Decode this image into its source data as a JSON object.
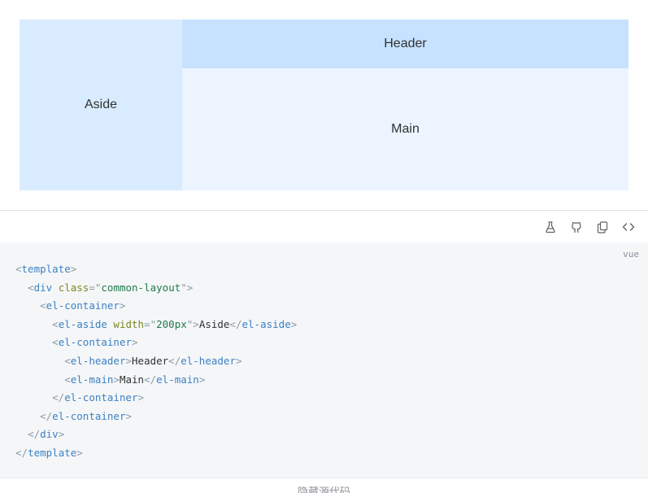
{
  "preview": {
    "aside_label": "Aside",
    "header_label": "Header",
    "main_label": "Main"
  },
  "toolbar": {
    "buttons": [
      "playground-icon",
      "github-icon",
      "copy-icon",
      "code-icon"
    ]
  },
  "code": {
    "language": "vue",
    "lines": [
      [
        {
          "t": "punc",
          "v": "<"
        },
        {
          "t": "tag",
          "v": "template"
        },
        {
          "t": "punc",
          "v": ">"
        }
      ],
      [
        {
          "t": "text",
          "v": "  "
        },
        {
          "t": "punc",
          "v": "<"
        },
        {
          "t": "tag",
          "v": "div "
        },
        {
          "t": "attr",
          "v": "class"
        },
        {
          "t": "punc",
          "v": "=\""
        },
        {
          "t": "str",
          "v": "common-layout"
        },
        {
          "t": "punc",
          "v": "\">"
        }
      ],
      [
        {
          "t": "text",
          "v": "    "
        },
        {
          "t": "punc",
          "v": "<"
        },
        {
          "t": "tag",
          "v": "el-container"
        },
        {
          "t": "punc",
          "v": ">"
        }
      ],
      [
        {
          "t": "text",
          "v": "      "
        },
        {
          "t": "punc",
          "v": "<"
        },
        {
          "t": "tag",
          "v": "el-aside "
        },
        {
          "t": "attr",
          "v": "width"
        },
        {
          "t": "punc",
          "v": "=\""
        },
        {
          "t": "str",
          "v": "200px"
        },
        {
          "t": "punc",
          "v": "\">"
        },
        {
          "t": "text",
          "v": "Aside"
        },
        {
          "t": "punc",
          "v": "</"
        },
        {
          "t": "tag",
          "v": "el-aside"
        },
        {
          "t": "punc",
          "v": ">"
        }
      ],
      [
        {
          "t": "text",
          "v": "      "
        },
        {
          "t": "punc",
          "v": "<"
        },
        {
          "t": "tag",
          "v": "el-container"
        },
        {
          "t": "punc",
          "v": ">"
        }
      ],
      [
        {
          "t": "text",
          "v": "        "
        },
        {
          "t": "punc",
          "v": "<"
        },
        {
          "t": "tag",
          "v": "el-header"
        },
        {
          "t": "punc",
          "v": ">"
        },
        {
          "t": "text",
          "v": "Header"
        },
        {
          "t": "punc",
          "v": "</"
        },
        {
          "t": "tag",
          "v": "el-header"
        },
        {
          "t": "punc",
          "v": ">"
        }
      ],
      [
        {
          "t": "text",
          "v": "        "
        },
        {
          "t": "punc",
          "v": "<"
        },
        {
          "t": "tag",
          "v": "el-main"
        },
        {
          "t": "punc",
          "v": ">"
        },
        {
          "t": "text",
          "v": "Main"
        },
        {
          "t": "punc",
          "v": "</"
        },
        {
          "t": "tag",
          "v": "el-main"
        },
        {
          "t": "punc",
          "v": ">"
        }
      ],
      [
        {
          "t": "text",
          "v": "      "
        },
        {
          "t": "punc",
          "v": "</"
        },
        {
          "t": "tag",
          "v": "el-container"
        },
        {
          "t": "punc",
          "v": ">"
        }
      ],
      [
        {
          "t": "text",
          "v": "    "
        },
        {
          "t": "punc",
          "v": "</"
        },
        {
          "t": "tag",
          "v": "el-container"
        },
        {
          "t": "punc",
          "v": ">"
        }
      ],
      [
        {
          "t": "text",
          "v": "  "
        },
        {
          "t": "punc",
          "v": "</"
        },
        {
          "t": "tag",
          "v": "div"
        },
        {
          "t": "punc",
          "v": ">"
        }
      ],
      [
        {
          "t": "punc",
          "v": "</"
        },
        {
          "t": "tag",
          "v": "template"
        },
        {
          "t": "punc",
          "v": ">"
        }
      ]
    ]
  },
  "footer": {
    "hide_source_label": "隐藏源代码"
  },
  "colors": {
    "aside_bg": "#d9ecff",
    "header_bg": "#c6e2ff",
    "main_bg": "#ecf5ff",
    "code_bg": "#f5f6f8"
  }
}
